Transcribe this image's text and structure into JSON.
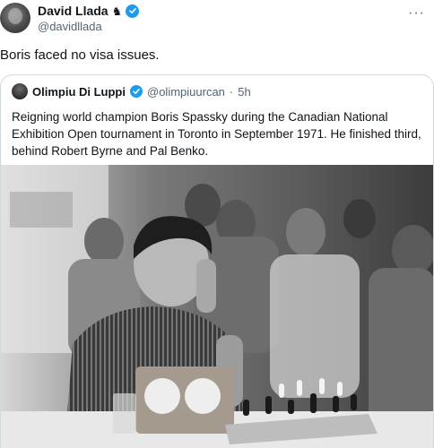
{
  "post": {
    "author_name": "David Llada",
    "author_badge_glyph": "♞",
    "author_handle": "@davidllada",
    "text": "Boris faced no visa issues.",
    "more_label": "···"
  },
  "quote": {
    "author_name": "Olimpiu Di Luppi",
    "author_handle": "@olimpiuurcan",
    "separator": "·",
    "time": "5h",
    "text": "Reigning world champion Boris Spassky during the Canadian National Exhibition Open tournament in Toronto in September 1971. He finished third, behind Robert Byrne and Pal Benko."
  },
  "icons": {
    "verified": "verified-badge-icon",
    "knight": "chess-knight-icon",
    "more": "more-options-icon"
  },
  "colors": {
    "text_primary": "#0f1419",
    "text_secondary": "#536471",
    "verified_blue": "#1d9bf0",
    "border": "#cfd9de"
  }
}
